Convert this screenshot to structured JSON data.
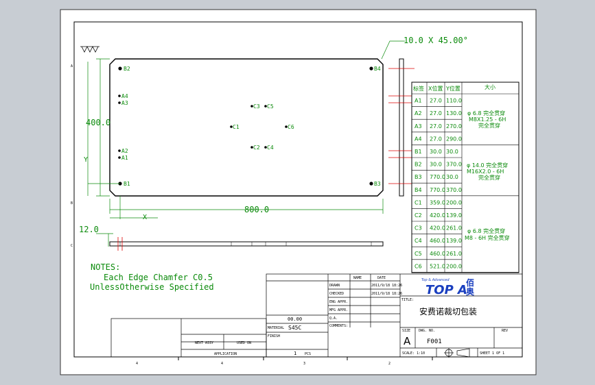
{
  "dims": {
    "chamfer": "10.0  X  45.00°",
    "height": "400.0",
    "width": "800.0",
    "thickness": "12.0",
    "x_axis": "X",
    "y_axis": "Y"
  },
  "notes": {
    "title": "NOTES:",
    "line1": "Each Edge Chamfer C0.5",
    "line2": "UnlessOtherwise Specified"
  },
  "hole_table": {
    "headers": [
      "标签",
      "X位置",
      "Y位置",
      "大小"
    ],
    "rows": [
      {
        "tag": "A1",
        "x": "27.0",
        "y": "110.0"
      },
      {
        "tag": "A2",
        "x": "27.0",
        "y": "130.0"
      },
      {
        "tag": "A3",
        "x": "27.0",
        "y": "270.0"
      },
      {
        "tag": "A4",
        "x": "27.0",
        "y": "290.0"
      },
      {
        "tag": "B1",
        "x": "30.0",
        "y": "30.0"
      },
      {
        "tag": "B2",
        "x": "30.0",
        "y": "370.0"
      },
      {
        "tag": "B3",
        "x": "770.0",
        "y": "30.0"
      },
      {
        "tag": "B4",
        "x": "770.0",
        "y": "370.0"
      },
      {
        "tag": "C1",
        "x": "359.0",
        "y": "200.0"
      },
      {
        "tag": "C2",
        "x": "420.0",
        "y": "139.0"
      },
      {
        "tag": "C3",
        "x": "420.0",
        "y": "261.0"
      },
      {
        "tag": "C4",
        "x": "460.0",
        "y": "139.0"
      },
      {
        "tag": "C5",
        "x": "460.0",
        "y": "261.0"
      },
      {
        "tag": "C6",
        "x": "521.0",
        "y": "200.0"
      }
    ],
    "sizes": [
      [
        "φ 6.8 完全贯穿",
        "M8X1.25 - 6H",
        "完全贯穿"
      ],
      [
        "φ 14.0 完全贯穿",
        "M16X2.0 - 6H",
        "完全贯穿"
      ],
      [
        "φ 6.8 完全贯穿",
        "M8 - 6H 完全贯穿"
      ]
    ]
  },
  "plate_labels": [
    "B2",
    "B4",
    "A4",
    "A3",
    "C3",
    "C5",
    "C1",
    "C6",
    "C2",
    "C4",
    "A2",
    "A1",
    "B1",
    "B3"
  ],
  "title_block": {
    "title_label": "TITLE:",
    "title": "安费诺裁切包装",
    "size_label": "SIZE",
    "size": "A",
    "dwg_label": "DWG.  NO.",
    "dwg_no": "F001",
    "rev_label": "REV",
    "scale": "SCALE: 1:10",
    "sheet": "SHEET 1 OF 1",
    "material": "S45C",
    "qty": "1",
    "pcs": "PCS",
    "company_en": "Top & Advanced",
    "company_logo": "TOP A",
    "company_cn1": "佰",
    "company_cn2": "奥",
    "drawn": "DRAWN",
    "checked": "CHECKED",
    "eng_appr": "ENG APPR.",
    "mfg_appr": "MFG APPR.",
    "qa": "Q.A.",
    "comments": "COMMENTS:",
    "name": "NAME",
    "date": "DATE",
    "date_drawn": "2011/9/18 18:26",
    "date_checked": "2011/9/18 18:26",
    "finish": "FINISH",
    "material_label": "MATERIAL",
    "next_assy": "NEXT ASSY",
    "used_on": "USED ON",
    "application": "APPLICATION",
    "tolerance": "00.00"
  },
  "zones": [
    "4",
    "3",
    "2",
    "1"
  ]
}
